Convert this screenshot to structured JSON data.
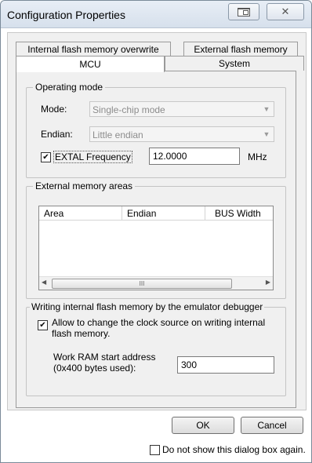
{
  "window": {
    "title": "Configuration Properties"
  },
  "tabs": {
    "back_row": [
      "Internal flash memory overwrite",
      "External flash memory"
    ],
    "front_row": [
      "MCU",
      "System"
    ]
  },
  "operating_mode": {
    "title": "Operating mode",
    "mode_label": "Mode:",
    "mode_value": "Single-chip mode",
    "endian_label": "Endian:",
    "endian_value": "Little endian",
    "extal_label": "EXTAL Frequency",
    "extal_checked": true,
    "extal_value": "12.0000",
    "extal_unit": "MHz"
  },
  "external_memory": {
    "title": "External memory areas",
    "columns": [
      "Area",
      "Endian",
      "BUS Width"
    ],
    "scroll_grip": "III"
  },
  "flash_writing": {
    "title": "Writing internal flash memory by the emulator debugger",
    "allow_label_line1": "Allow to change the clock source on writing internal",
    "allow_label_line2": "flash memory.",
    "allow_checked": true,
    "ram_label_line1": "Work RAM start address",
    "ram_label_line2": "(0x400 bytes used):",
    "ram_value": "300"
  },
  "footer": {
    "ok_label": "OK",
    "cancel_label": "Cancel",
    "dont_show_label": "Do not show this dialog box again.",
    "dont_show_checked": false
  }
}
